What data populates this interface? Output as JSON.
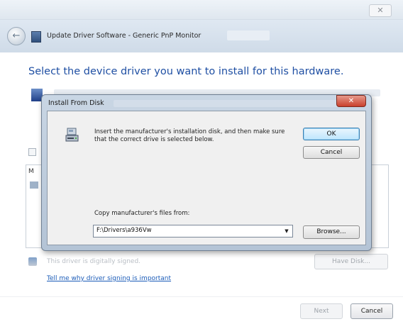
{
  "wizard": {
    "title": "Update Driver Software - Generic PnP Monitor",
    "close_glyph": "✕",
    "back_glyph": "←",
    "heading": "Select the device driver you want to install for this hardware.",
    "list_label": "M",
    "signed_text": "This driver is digitally signed.",
    "signing_link": "Tell me why driver signing is important",
    "have_disk_label": "Have Disk...",
    "next_label": "Next",
    "cancel_label": "Cancel"
  },
  "dialog": {
    "title": "Install From Disk",
    "close_glyph": "✕",
    "instruction": "Insert the manufacturer's installation disk, and then make sure that the correct drive is selected below.",
    "ok_label": "OK",
    "cancel_label": "Cancel",
    "copy_label": "Copy manufacturer's files from:",
    "path_value": "F:\\Drivers\\a936Vw",
    "dropdown_glyph": "▼",
    "browse_label": "Browse..."
  },
  "icons": {
    "disk": "disk-drive-icon",
    "hardware": "monitor-hardware-icon",
    "shield": "shield-icon"
  },
  "colors": {
    "heading": "#1f4fa3",
    "link": "#1a5bb8",
    "close_red": "#c9402c",
    "ok_blue": "#3c7fb1"
  }
}
